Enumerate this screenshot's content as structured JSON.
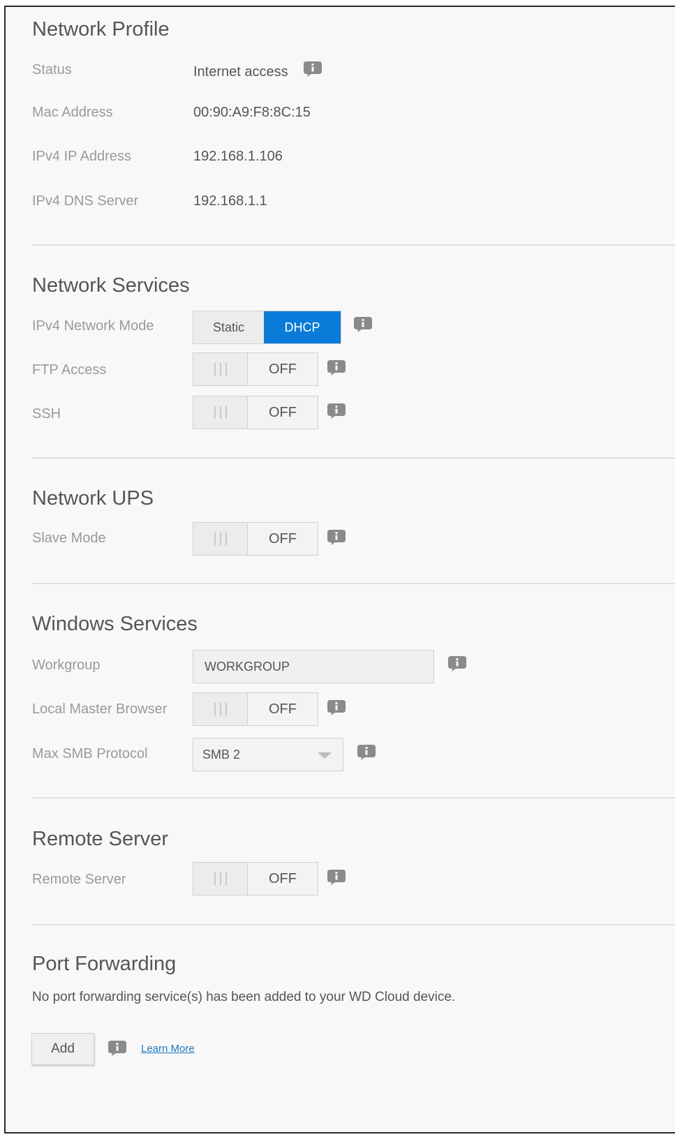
{
  "network_profile": {
    "title": "Network Profile",
    "rows": [
      {
        "label": "Status",
        "value": "Internet access"
      },
      {
        "label": "Mac Address",
        "value": "00:90:A9:F8:8C:15"
      },
      {
        "label": "IPv4 IP Address",
        "value": "192.168.1.106"
      },
      {
        "label": "IPv4 DNS Server",
        "value": "192.168.1.1"
      }
    ]
  },
  "network_services": {
    "title": "Network Services",
    "ipv4_mode": {
      "label": "IPv4 Network Mode",
      "options": [
        "Static",
        "DHCP"
      ],
      "selected": "DHCP"
    },
    "ftp": {
      "label": "FTP Access",
      "state": "OFF"
    },
    "ssh": {
      "label": "SSH",
      "state": "OFF"
    }
  },
  "network_ups": {
    "title": "Network UPS",
    "slave": {
      "label": "Slave Mode",
      "state": "OFF"
    }
  },
  "windows_services": {
    "title": "Windows Services",
    "workgroup": {
      "label": "Workgroup",
      "value": "WORKGROUP"
    },
    "local_master": {
      "label": "Local Master Browser",
      "state": "OFF"
    },
    "smb": {
      "label": "Max SMB Protocol",
      "value": "SMB 2"
    }
  },
  "remote_server": {
    "title": "Remote Server",
    "toggle": {
      "label": "Remote Server",
      "state": "OFF"
    }
  },
  "port_forwarding": {
    "title": "Port Forwarding",
    "message": "No port forwarding service(s) has been added to your WD Cloud device.",
    "add_label": "Add",
    "learn_more": "Learn More"
  },
  "colors": {
    "accent": "#0a7bd8",
    "link": "#1a78c2"
  },
  "icons": {
    "info": "info-icon",
    "dropdown": "chevron-down-icon"
  }
}
